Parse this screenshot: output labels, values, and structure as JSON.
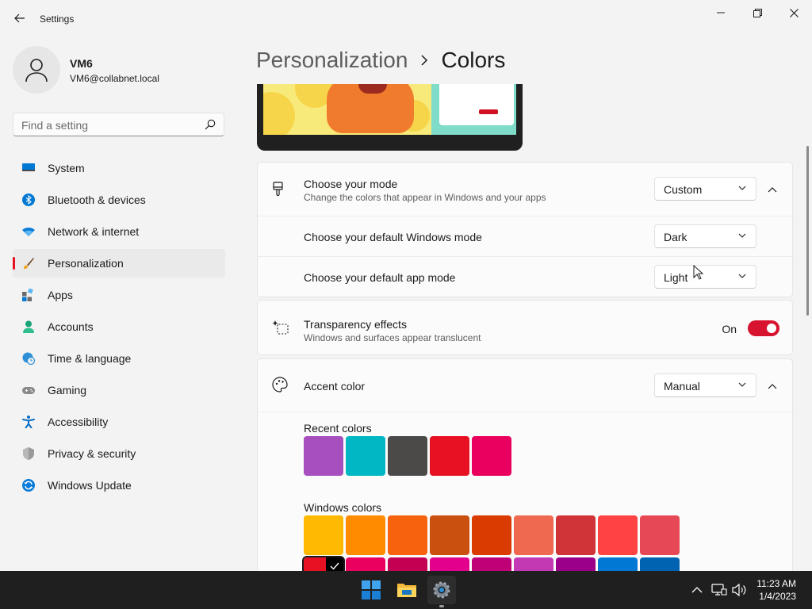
{
  "window": {
    "title": "Settings"
  },
  "user": {
    "name": "VM6",
    "email": "VM6@collabnet.local"
  },
  "search": {
    "placeholder": "Find a setting"
  },
  "nav": [
    {
      "label": "System",
      "icon": "monitor-icon"
    },
    {
      "label": "Bluetooth & devices",
      "icon": "bluetooth-icon"
    },
    {
      "label": "Network & internet",
      "icon": "wifi-icon"
    },
    {
      "label": "Personalization",
      "icon": "brush-icon",
      "active": true
    },
    {
      "label": "Apps",
      "icon": "apps-icon"
    },
    {
      "label": "Accounts",
      "icon": "person-icon"
    },
    {
      "label": "Time & language",
      "icon": "globe-clock-icon"
    },
    {
      "label": "Gaming",
      "icon": "gamepad-icon"
    },
    {
      "label": "Accessibility",
      "icon": "accessibility-icon"
    },
    {
      "label": "Privacy & security",
      "icon": "shield-icon"
    },
    {
      "label": "Windows Update",
      "icon": "update-icon"
    }
  ],
  "breadcrumb": {
    "parent": "Personalization",
    "current": "Colors"
  },
  "mode": {
    "title": "Choose your mode",
    "description": "Change the colors that appear in Windows and your apps",
    "value": "Custom",
    "windows_mode": {
      "label": "Choose your default Windows mode",
      "value": "Dark"
    },
    "app_mode": {
      "label": "Choose your default app mode",
      "value": "Light"
    }
  },
  "transparency": {
    "title": "Transparency effects",
    "description": "Windows and surfaces appear translucent",
    "state_label": "On",
    "on": true
  },
  "accent": {
    "title": "Accent color",
    "value": "Manual",
    "recent_label": "Recent colors",
    "recent_colors": [
      "#a74fbf",
      "#00b7c3",
      "#4c4a48",
      "#e81123",
      "#ea005e"
    ],
    "windows_label": "Windows colors",
    "windows_colors_row1": [
      "#ffb900",
      "#ff8c00",
      "#f7630c",
      "#ca5010",
      "#da3b01",
      "#ef6950",
      "#d13438",
      "#ff4343",
      "#e74856"
    ],
    "windows_colors_row2": [
      "#e81123",
      "#ea005e",
      "#c30052",
      "#e3008c",
      "#bf0077",
      "#c239b3",
      "#9a0089",
      "#0078d4",
      "#0063b1"
    ],
    "selected_color": "#e81123"
  },
  "taskbar": {
    "time": "11:23 AM",
    "date": "1/4/2023"
  }
}
